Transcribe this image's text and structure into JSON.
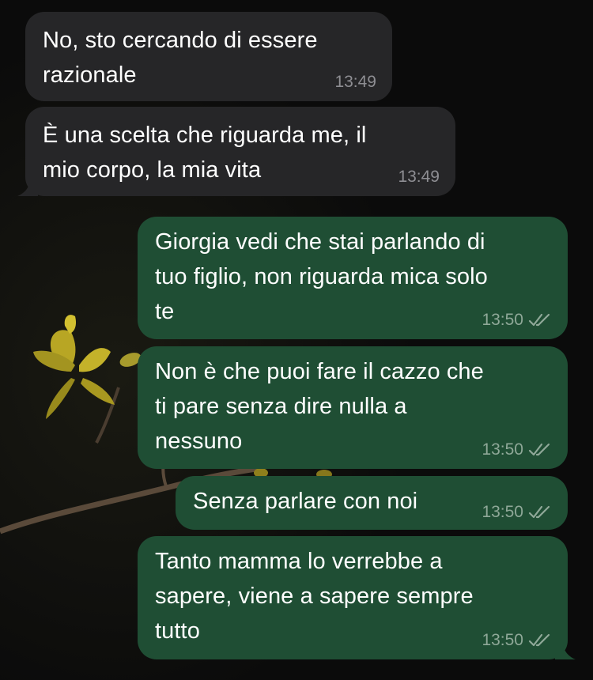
{
  "chat": {
    "messages": [
      {
        "direction": "in",
        "text": "No, sto cercando di essere\nrazionale",
        "time": "13:49"
      },
      {
        "direction": "in",
        "text": "È una scelta che riguarda me, il\nmio corpo, la mia vita",
        "time": "13:49"
      },
      {
        "direction": "out",
        "text": "Giorgia vedi che stai parlando di\ntuo figlio, non riguarda mica solo\nte",
        "time": "13:50",
        "status": "read"
      },
      {
        "direction": "out",
        "text": "Non è che puoi fare il cazzo che\nti pare senza dire nulla a\nnessuno",
        "time": "13:50",
        "status": "read"
      },
      {
        "direction": "out",
        "text": "Senza parlare con noi",
        "time": "13:50",
        "status": "read"
      },
      {
        "direction": "out",
        "text": "Tanto mamma lo verrebbe a\nsapere, viene a sapere sempre\ntutto",
        "time": "13:50",
        "status": "read"
      }
    ]
  },
  "colors": {
    "background": "#0b0b0b",
    "incoming_bubble": "#262628",
    "outgoing_bubble": "#1f4e34",
    "timestamp_incoming": "#8e8e93",
    "timestamp_outgoing": "#8fa898"
  },
  "icons": {
    "read_receipt": "double-check-icon",
    "wallpaper": "yellow-flower-branch"
  }
}
